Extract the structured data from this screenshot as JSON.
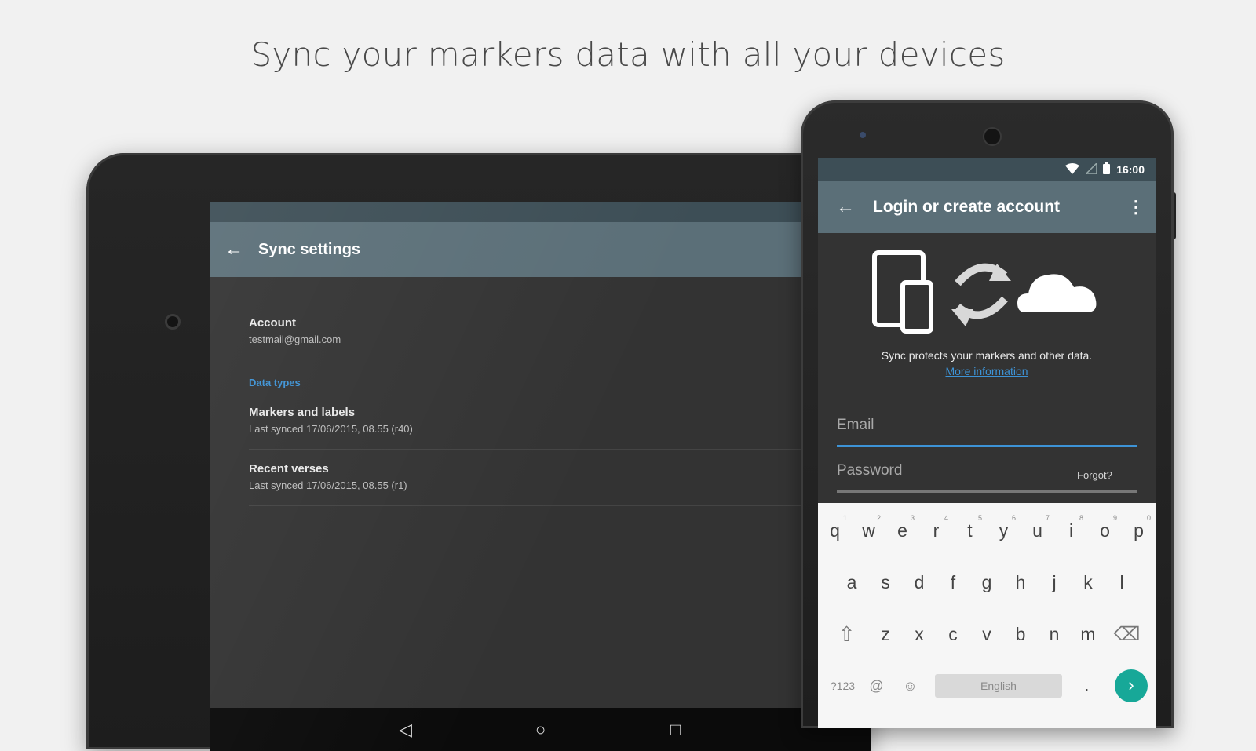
{
  "headline": "Sync your markers data with all your devices",
  "tablet": {
    "toolbar": {
      "back_icon": "arrow-back-icon",
      "title": "Sync settings"
    },
    "account": {
      "label": "Account",
      "email": "testmail@gmail.com"
    },
    "section_header": "Data types",
    "items": [
      {
        "title": "Markers and labels",
        "subtitle": "Last synced 17/06/2015, 08.55 (r40)"
      },
      {
        "title": "Recent verses",
        "subtitle": "Last synced 17/06/2015, 08.55 (r1)"
      }
    ],
    "navbar": {
      "back": "◁",
      "home": "○",
      "recents": "□"
    }
  },
  "phone": {
    "status": {
      "time": "16:00",
      "wifi_icon": "wifi-icon",
      "signal_icon": "signal-icon",
      "battery_icon": "battery-icon"
    },
    "toolbar": {
      "title": "Login or create account",
      "back_icon": "arrow-back-icon",
      "menu_icon": "more-vert-icon"
    },
    "message": "Sync protects your markers and other data.",
    "more_info_link": "More information",
    "email_placeholder": "Email",
    "password_placeholder": "Password",
    "forgot_label": "Forgot?",
    "accent_color": "#3d93d6",
    "keyboard": {
      "row1": [
        "q",
        "w",
        "e",
        "r",
        "t",
        "y",
        "u",
        "i",
        "o",
        "p"
      ],
      "row1_hints": [
        "1",
        "2",
        "3",
        "4",
        "5",
        "6",
        "7",
        "8",
        "9",
        "0"
      ],
      "row2": [
        "a",
        "s",
        "d",
        "f",
        "g",
        "h",
        "j",
        "k",
        "l"
      ],
      "row3": [
        "z",
        "x",
        "c",
        "v",
        "b",
        "n",
        "m"
      ],
      "symbols_label": "?123",
      "at_label": "@",
      "space_label": "English",
      "period_label": ".",
      "enter_label": "›"
    }
  }
}
